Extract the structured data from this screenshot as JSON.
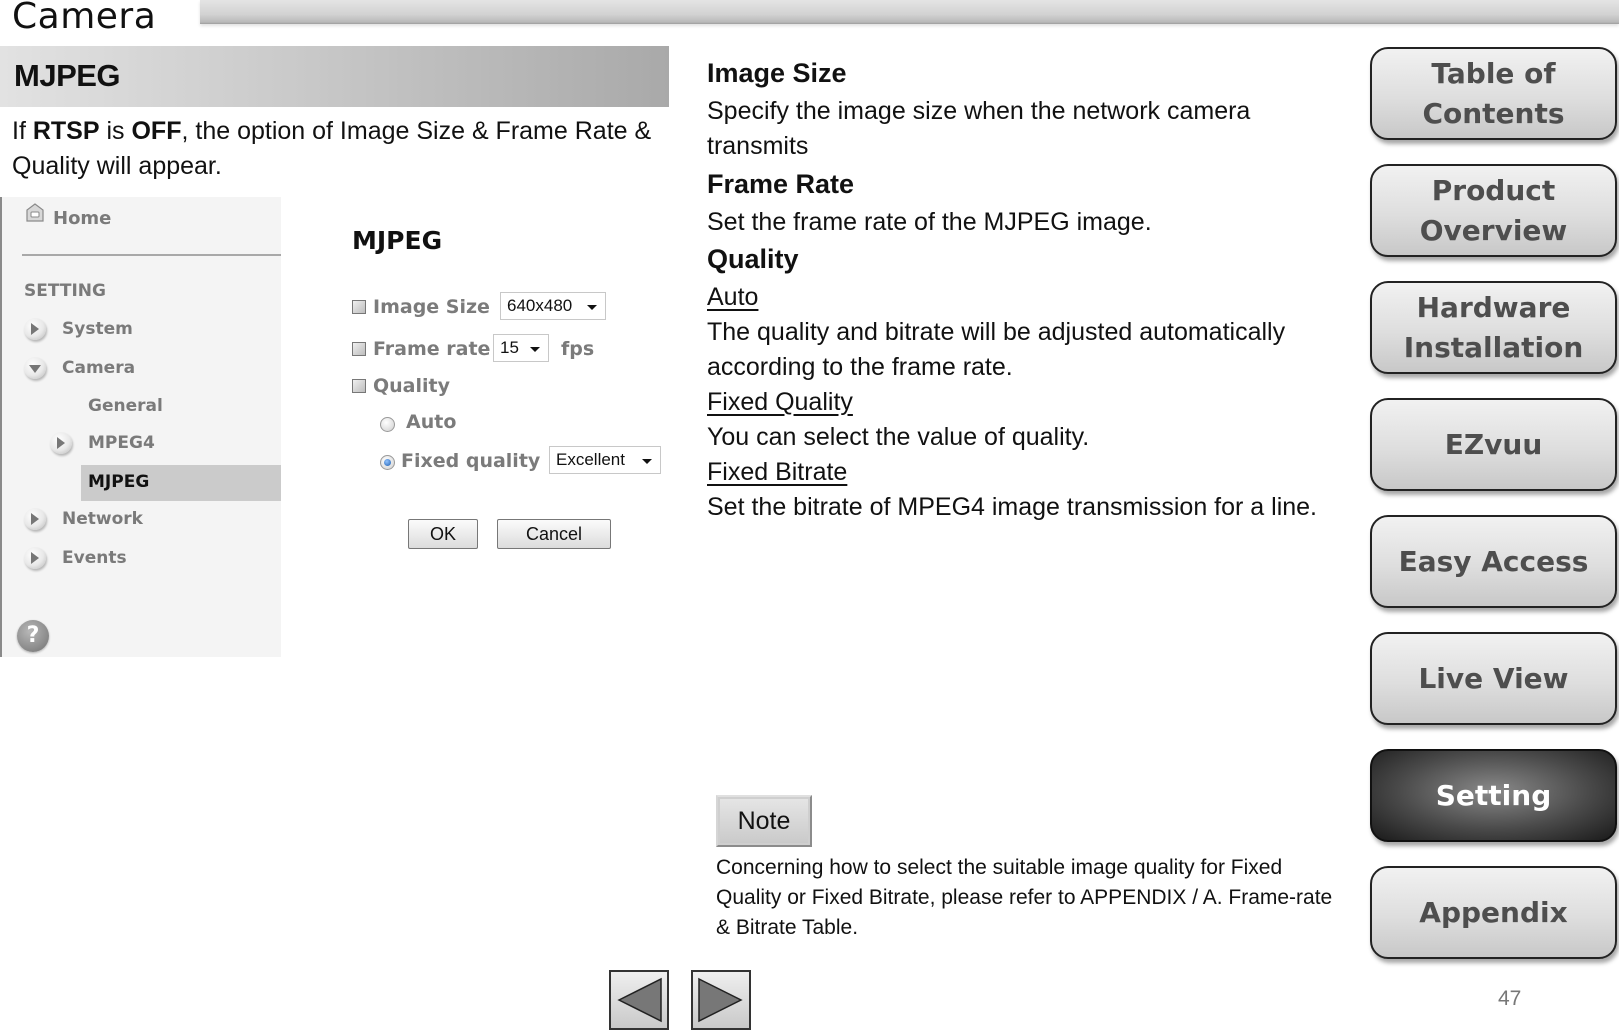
{
  "header": {
    "chapter_title": "Camera"
  },
  "section": {
    "title": "MJPEG",
    "intro": {
      "prefix": "If ",
      "rtsp": "RTSP",
      "mid": " is ",
      "off": "OFF",
      "suffix": ", the option of Image Size & Frame Rate & Quality will appear."
    }
  },
  "screenshot_sidebar": {
    "home": "Home",
    "setting_heading": "SETTING",
    "items": [
      {
        "label": "System",
        "state": "collapsed"
      },
      {
        "label": "Camera",
        "state": "expanded"
      },
      {
        "label": "General",
        "state": "sub"
      },
      {
        "label": "MPEG4",
        "state": "collapsed-sub"
      },
      {
        "label": "MJPEG",
        "state": "selected"
      },
      {
        "label": "Network",
        "state": "collapsed"
      },
      {
        "label": "Events",
        "state": "collapsed"
      }
    ],
    "help": "?"
  },
  "screenshot_form": {
    "title": "MJPEG",
    "image_size_label": "Image Size",
    "image_size_value": "640x480",
    "frame_rate_label": "Frame rate",
    "frame_rate_value": "15",
    "frame_rate_unit": "fps",
    "quality_label": "Quality",
    "auto_label": "Auto",
    "fixed_quality_label": "Fixed quality",
    "fixed_quality_value": "Excellent",
    "selected_quality_mode": "Fixed quality",
    "ok_label": "OK",
    "cancel_label": "Cancel"
  },
  "descriptions": {
    "image_size_heading": "Image Size",
    "image_size_text": "Specify the image size when the network camera transmits",
    "frame_rate_heading": "Frame Rate",
    "frame_rate_text": "Set the frame rate of the MJPEG image.",
    "quality_heading": "Quality",
    "auto_heading": "Auto",
    "auto_text": "The quality and bitrate will be adjusted automatically according to the frame rate.",
    "fixed_quality_heading": "Fixed Quality",
    "fixed_quality_text": "You can select the value of quality.",
    "fixed_bitrate_heading": "Fixed Bitrate",
    "fixed_bitrate_text": "Set the bitrate of MPEG4 image transmission for a line."
  },
  "note": {
    "label": "Note",
    "text": "Concerning how to select the suitable image quality for Fixed Quality or Fixed Bitrate, please refer to APPENDIX / A. Frame-rate & Bitrate Table."
  },
  "nav": {
    "buttons": [
      {
        "label": "Table of Contents",
        "active": false
      },
      {
        "label": "Product Overview",
        "active": false
      },
      {
        "label": "Hardware Installation",
        "active": false
      },
      {
        "label": "EZvuu",
        "active": false
      },
      {
        "label": "Easy Access",
        "active": false
      },
      {
        "label": "Live View",
        "active": false
      },
      {
        "label": "Setting",
        "active": true
      },
      {
        "label": "Appendix",
        "active": false
      }
    ],
    "prev_icon": "triangle-left",
    "next_icon": "triangle-right"
  },
  "footer": {
    "page_number": "47"
  }
}
